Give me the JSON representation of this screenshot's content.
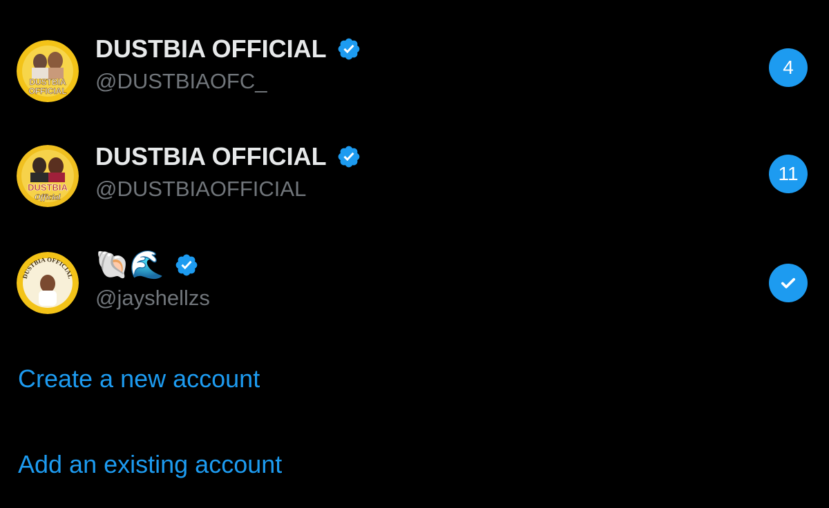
{
  "accounts": [
    {
      "name": "DUSTBIA OFFICIAL",
      "handle": "@DUSTBIAOFC_",
      "verified": true,
      "badge": "4",
      "avatar": {
        "text_top": "DUSTBIA",
        "text_bottom": "OFFICIAL"
      }
    },
    {
      "name": "DUSTBIA OFFICIAL",
      "handle": "@DUSTBIAOFFICIAL",
      "verified": true,
      "badge": "11",
      "avatar": {
        "text_top": "DUSTBIA",
        "text_bottom": "Official"
      }
    },
    {
      "name_emoji": "🐚🌊",
      "handle": "@jayshellzs",
      "verified": true,
      "active": true,
      "avatar": {
        "text_ring": "DUSTBIA OFFICIAL"
      }
    }
  ],
  "actions": {
    "create": "Create a new account",
    "add": "Add an existing account"
  },
  "colors": {
    "background": "#000000",
    "accent": "#1d9bf0",
    "primary_text": "#e7e9ea",
    "secondary_text": "#71767b",
    "avatar_gold": "#f3c318"
  }
}
